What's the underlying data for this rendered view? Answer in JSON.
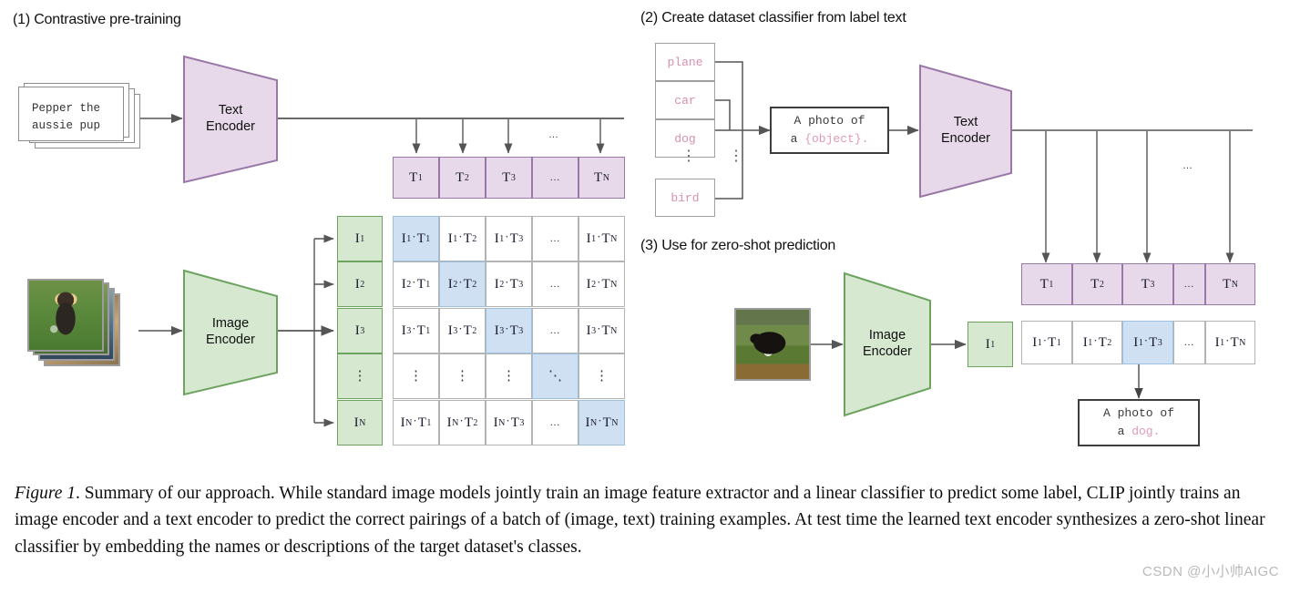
{
  "figure": {
    "caption_prefix": "Figure 1",
    "caption_body": ". Summary of our approach. While standard image models jointly train an image feature extractor and a linear classifier to predict some label, CLIP jointly trains an image encoder and a text encoder to predict the correct pairings of a batch of (image, text) training examples. At test time the learned text encoder synthesizes a zero-shot linear classifier by embedding the names or descriptions of the target dataset's classes.",
    "watermark": "CSDN @小小帅AIGC"
  },
  "sections": {
    "one": {
      "title": "(1) Contrastive pre-training"
    },
    "two": {
      "title": "(2) Create dataset classifier from label text"
    },
    "three": {
      "title": "(3) Use for zero-shot prediction"
    }
  },
  "encoders": {
    "text": {
      "line1": "Text",
      "line2": "Encoder",
      "fill": "#e7d8ea",
      "stroke": "#9a77a8"
    },
    "image": {
      "line1": "Image",
      "line2": "Encoder",
      "fill": "#d6e8d0",
      "stroke": "#6ca35e"
    }
  },
  "input_text": {
    "line1": "Pepper the",
    "line2": "aussie pup"
  },
  "matrix": {
    "text_headers": [
      "T",
      "T",
      "T",
      "…",
      "T"
    ],
    "text_subs": [
      "1",
      "2",
      "3",
      "",
      "N"
    ],
    "image_headers": [
      "I",
      "I",
      "I",
      "⋮",
      "I"
    ],
    "image_subs": [
      "1",
      "2",
      "3",
      "",
      "N"
    ],
    "rows": [
      [
        {
          "i": "1",
          "t": "1",
          "hl": true
        },
        {
          "i": "1",
          "t": "2",
          "hl": false
        },
        {
          "i": "1",
          "t": "3",
          "hl": false
        },
        {
          "ell": true,
          "hl": false
        },
        {
          "i": "1",
          "t": "N",
          "hl": false
        }
      ],
      [
        {
          "i": "2",
          "t": "1",
          "hl": false
        },
        {
          "i": "2",
          "t": "2",
          "hl": true
        },
        {
          "i": "2",
          "t": "3",
          "hl": false
        },
        {
          "ell": true,
          "hl": false
        },
        {
          "i": "2",
          "t": "N",
          "hl": false
        }
      ],
      [
        {
          "i": "3",
          "t": "1",
          "hl": false
        },
        {
          "i": "3",
          "t": "2",
          "hl": false
        },
        {
          "i": "3",
          "t": "3",
          "hl": true
        },
        {
          "ell": true,
          "hl": false
        },
        {
          "i": "3",
          "t": "N",
          "hl": false
        }
      ],
      [
        {
          "vell": true,
          "hl": false
        },
        {
          "vell": true,
          "hl": false
        },
        {
          "vell": true,
          "hl": false
        },
        {
          "diag": true,
          "hl": true
        },
        {
          "vell": true,
          "hl": false
        }
      ],
      [
        {
          "i": "N",
          "t": "1",
          "hl": false
        },
        {
          "i": "N",
          "t": "2",
          "hl": false
        },
        {
          "i": "N",
          "t": "3",
          "hl": false
        },
        {
          "ell": true,
          "hl": false
        },
        {
          "i": "N",
          "t": "N",
          "hl": true
        }
      ]
    ],
    "ellipsis_top": "…"
  },
  "classifier": {
    "labels": [
      "plane",
      "car",
      "dog",
      "bird"
    ],
    "label_ellipsis": "⋮",
    "prompt_line1": "A photo of",
    "prompt_line2_prefix": "a ",
    "prompt_line2_token": "{object}.",
    "ellipsis_top": "…"
  },
  "zeroshot": {
    "feature_label": "I",
    "feature_sub": "1",
    "text_headers": [
      "T",
      "T",
      "T",
      "…",
      "T"
    ],
    "text_subs": [
      "1",
      "2",
      "3",
      "",
      "N"
    ],
    "scores": [
      {
        "i": "1",
        "t": "1",
        "hl": false
      },
      {
        "i": "1",
        "t": "2",
        "hl": false
      },
      {
        "i": "1",
        "t": "3",
        "hl": true
      },
      {
        "ell": true,
        "hl": false
      },
      {
        "i": "1",
        "t": "N",
        "hl": false
      }
    ],
    "result_line1": "A photo of",
    "result_line2_prefix": "a ",
    "result_line2_token": "dog."
  },
  "colors": {
    "text_fill": "#e7d8ea",
    "text_stroke": "#9a77a8",
    "image_fill": "#d6e8d0",
    "image_stroke": "#6ca35e",
    "highlight": "#cfe0f3",
    "label_pink": "#d98fae",
    "arrow": "#555555"
  }
}
